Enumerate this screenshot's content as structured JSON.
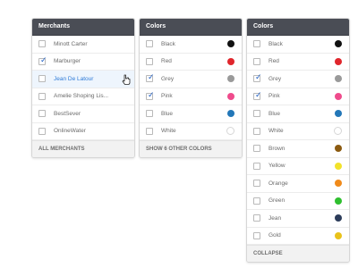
{
  "panels": {
    "merchants": {
      "title": "Merchants",
      "items": [
        {
          "label": "Minott Carter",
          "checked": false
        },
        {
          "label": "Marburger",
          "checked": true
        },
        {
          "label": "Jean De Latour",
          "checked": false
        },
        {
          "label": "Amelie Shoping Lis...",
          "checked": false
        },
        {
          "label": "BestSever",
          "checked": false
        },
        {
          "label": "OnlineWater",
          "checked": false
        }
      ],
      "footer": "ALL MERCHANTS"
    },
    "colors_a": {
      "title": "Colors",
      "items": [
        {
          "label": "Black",
          "checked": false,
          "color": "#111111"
        },
        {
          "label": "Red",
          "checked": false,
          "color": "#e0262c"
        },
        {
          "label": "Grey",
          "checked": true,
          "color": "#9a9a9a"
        },
        {
          "label": "Pink",
          "checked": true,
          "color": "#ef4b8c"
        },
        {
          "label": "Blue",
          "checked": false,
          "color": "#2377b8"
        },
        {
          "label": "White",
          "checked": false,
          "color": "#ffffff"
        }
      ],
      "footer": "SHOW 6 OTHER COLORS"
    },
    "colors_b": {
      "title": "Colors",
      "items": [
        {
          "label": "Black",
          "checked": false,
          "color": "#111111"
        },
        {
          "label": "Red",
          "checked": false,
          "color": "#e0262c"
        },
        {
          "label": "Grey",
          "checked": true,
          "color": "#9a9a9a"
        },
        {
          "label": "Pink",
          "checked": true,
          "color": "#ef4b8c"
        },
        {
          "label": "Blue",
          "checked": false,
          "color": "#2377b8"
        },
        {
          "label": "White",
          "checked": false,
          "color": "#ffffff"
        },
        {
          "label": "Brown",
          "checked": false,
          "color": "#8b5a10"
        },
        {
          "label": "Yellow",
          "checked": false,
          "color": "#f2e22a"
        },
        {
          "label": "Orange",
          "checked": false,
          "color": "#f08a1a"
        },
        {
          "label": "Green",
          "checked": false,
          "color": "#2fbf2f"
        },
        {
          "label": "Jean",
          "checked": false,
          "color": "#2c3c5a"
        },
        {
          "label": "Gold",
          "checked": false,
          "color": "#e9c21a"
        }
      ],
      "footer": "COLLAPSE"
    }
  }
}
